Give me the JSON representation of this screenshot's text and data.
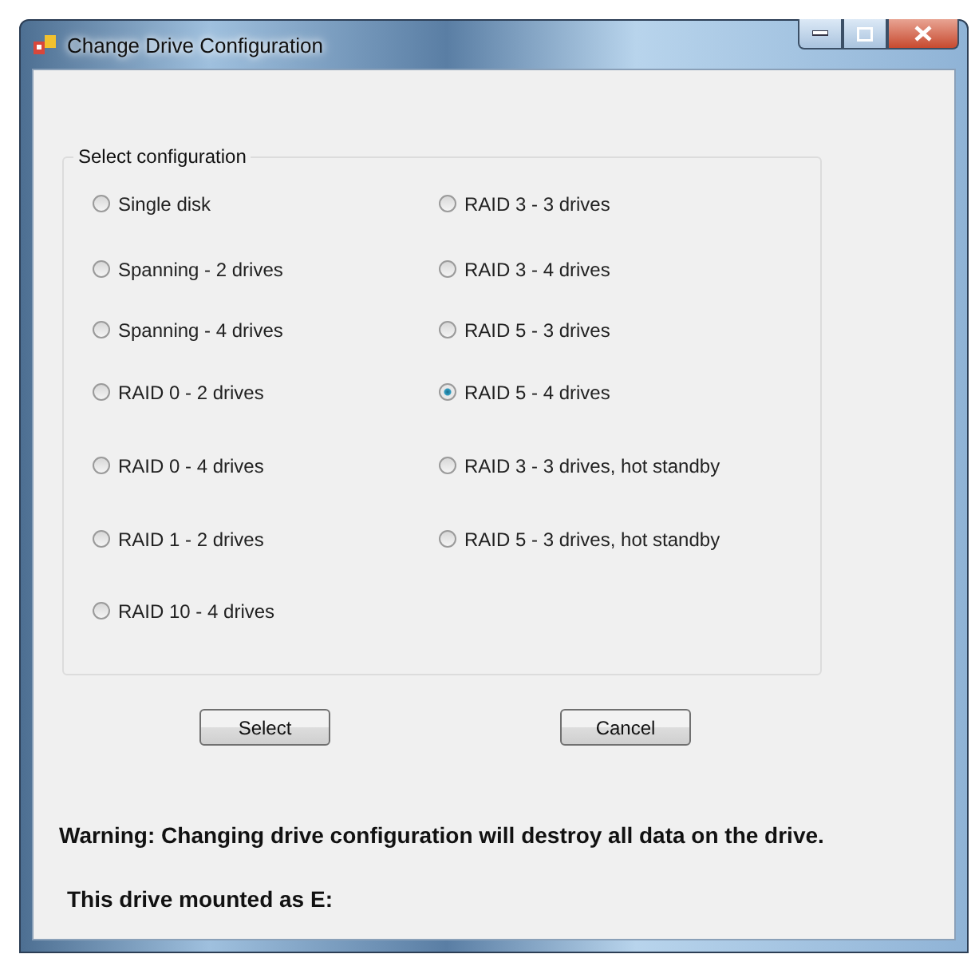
{
  "window": {
    "title": "Change Drive Configuration"
  },
  "group": {
    "title": "Select configuration",
    "columns": [
      [
        {
          "label": "Single disk",
          "selected": false
        },
        {
          "label": "Spanning - 2 drives",
          "selected": false
        },
        {
          "label": "Spanning - 4 drives",
          "selected": false
        },
        {
          "label": "RAID 0 - 2 drives",
          "selected": false
        },
        {
          "label": "RAID 0 - 4 drives",
          "selected": false
        },
        {
          "label": "RAID 1 - 2 drives",
          "selected": false
        },
        {
          "label": "RAID 10 - 4 drives",
          "selected": false
        }
      ],
      [
        {
          "label": "RAID 3 - 3 drives",
          "selected": false
        },
        {
          "label": "RAID 3 - 4 drives",
          "selected": false
        },
        {
          "label": "RAID 5 - 3 drives",
          "selected": false
        },
        {
          "label": "RAID 5 - 4 drives",
          "selected": true
        },
        {
          "label": "RAID 3 - 3 drives, hot standby",
          "selected": false
        },
        {
          "label": "RAID 5 - 3 drives, hot standby",
          "selected": false
        }
      ]
    ]
  },
  "buttons": [
    "Select",
    "Cancel"
  ],
  "warning": "Warning: Changing drive configuration will destroy all data on the drive.",
  "mount_info": "This drive mounted as E:"
}
